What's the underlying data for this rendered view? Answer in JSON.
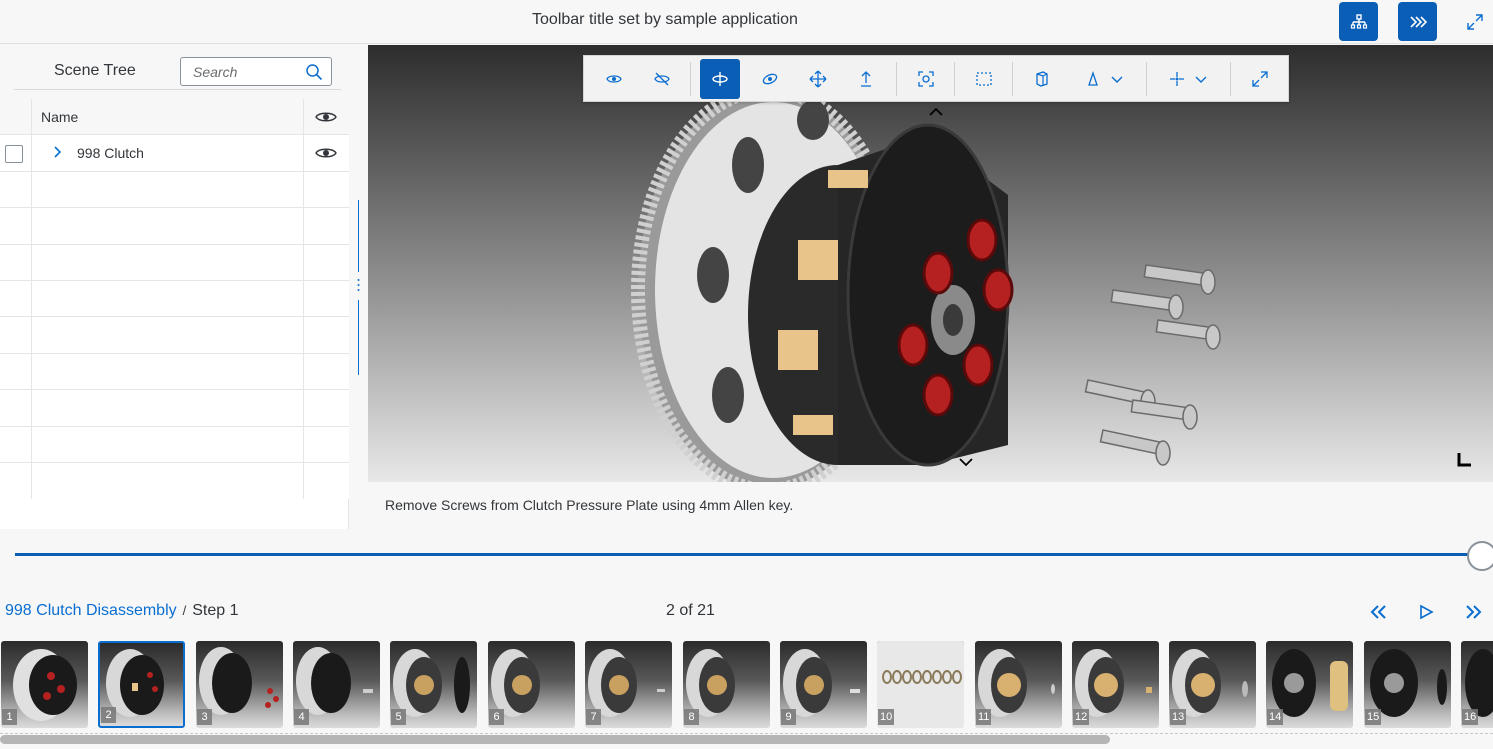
{
  "header": {
    "title": "Toolbar title set by sample application"
  },
  "scene_tree": {
    "title": "Scene Tree",
    "search_placeholder": "Search",
    "column_name": "Name",
    "nodes": [
      {
        "label": "998 Clutch"
      }
    ]
  },
  "caption": "Remove Screws from Clutch Pressure Plate using 4mm Allen key.",
  "procedure": {
    "name": "998 Clutch Disassembly",
    "separator": "/",
    "step": "Step 1",
    "counter": "2 of 21",
    "slider_fraction": 1.0
  },
  "thumbnails": [
    "1",
    "2",
    "3",
    "4",
    "5",
    "6",
    "7",
    "8",
    "9",
    "10",
    "11",
    "12",
    "13",
    "14",
    "15",
    "16"
  ],
  "selected_thumbnail": "2",
  "colors": {
    "accent": "#0a5eb5",
    "link": "#0a6ed1"
  }
}
